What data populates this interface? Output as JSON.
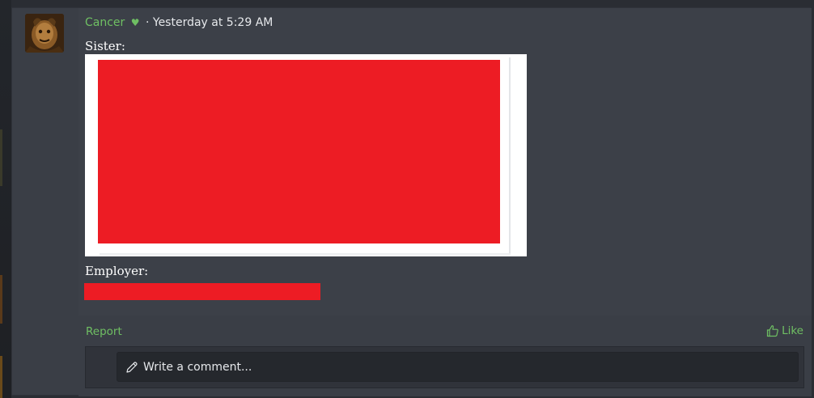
{
  "post": {
    "username": "Cancer",
    "separator": "·",
    "timestamp": "Yesterday at 5:29 AM",
    "sister_label": "Sister:",
    "employer_label": "Employer:"
  },
  "footer": {
    "report_label": "Report",
    "like_label": "Like"
  },
  "comment": {
    "placeholder": "Write a comment..."
  },
  "icons": {
    "heart": "heart-icon",
    "like": "thumbs-up-icon",
    "comment": "pencil-icon"
  },
  "colors": {
    "accent_green": "#6fbf63",
    "redaction_red": "#ed1c24",
    "panel_bg": "#3c4048",
    "input_bg": "#25282d"
  }
}
